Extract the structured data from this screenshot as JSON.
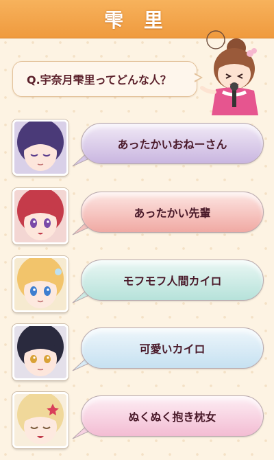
{
  "header": {
    "title": "雫 里",
    "color": "#ef9a3e"
  },
  "question": {
    "text": "Q.宇奈月雫里ってどんな人？"
  },
  "answers": [
    {
      "label": "あったかいおねーさん",
      "bubble_top": "#f1e9f6",
      "bubble_bottom": "#c9b6e0",
      "hair": "#4a3a78",
      "eyes": "closed",
      "eye_color": "#5b3d8c"
    },
    {
      "label": "あったかい先輩",
      "bubble_top": "#fde6e3",
      "bubble_bottom": "#f0a9a3",
      "hair": "#c53b4a",
      "eyes": "open",
      "eye_color": "#7a4aa8"
    },
    {
      "label": "モフモフ人間カイロ",
      "bubble_top": "#eaf7f4",
      "bubble_bottom": "#b6e2da",
      "hair": "#f2c46b",
      "eyes": "open",
      "eye_color": "#3e7fd0"
    },
    {
      "label": "可愛いカイロ",
      "bubble_top": "#eef6fb",
      "bubble_bottom": "#c6e1f1",
      "hair": "#2a2a3e",
      "eyes": "open",
      "eye_color": "#d9a236"
    },
    {
      "label": "ぬくぬく抱き枕女",
      "bubble_top": "#fdeef4",
      "bubble_bottom": "#f3bcd3",
      "hair": "#f0d89a",
      "eyes": "closed",
      "eye_color": "#7a5a3a"
    }
  ]
}
